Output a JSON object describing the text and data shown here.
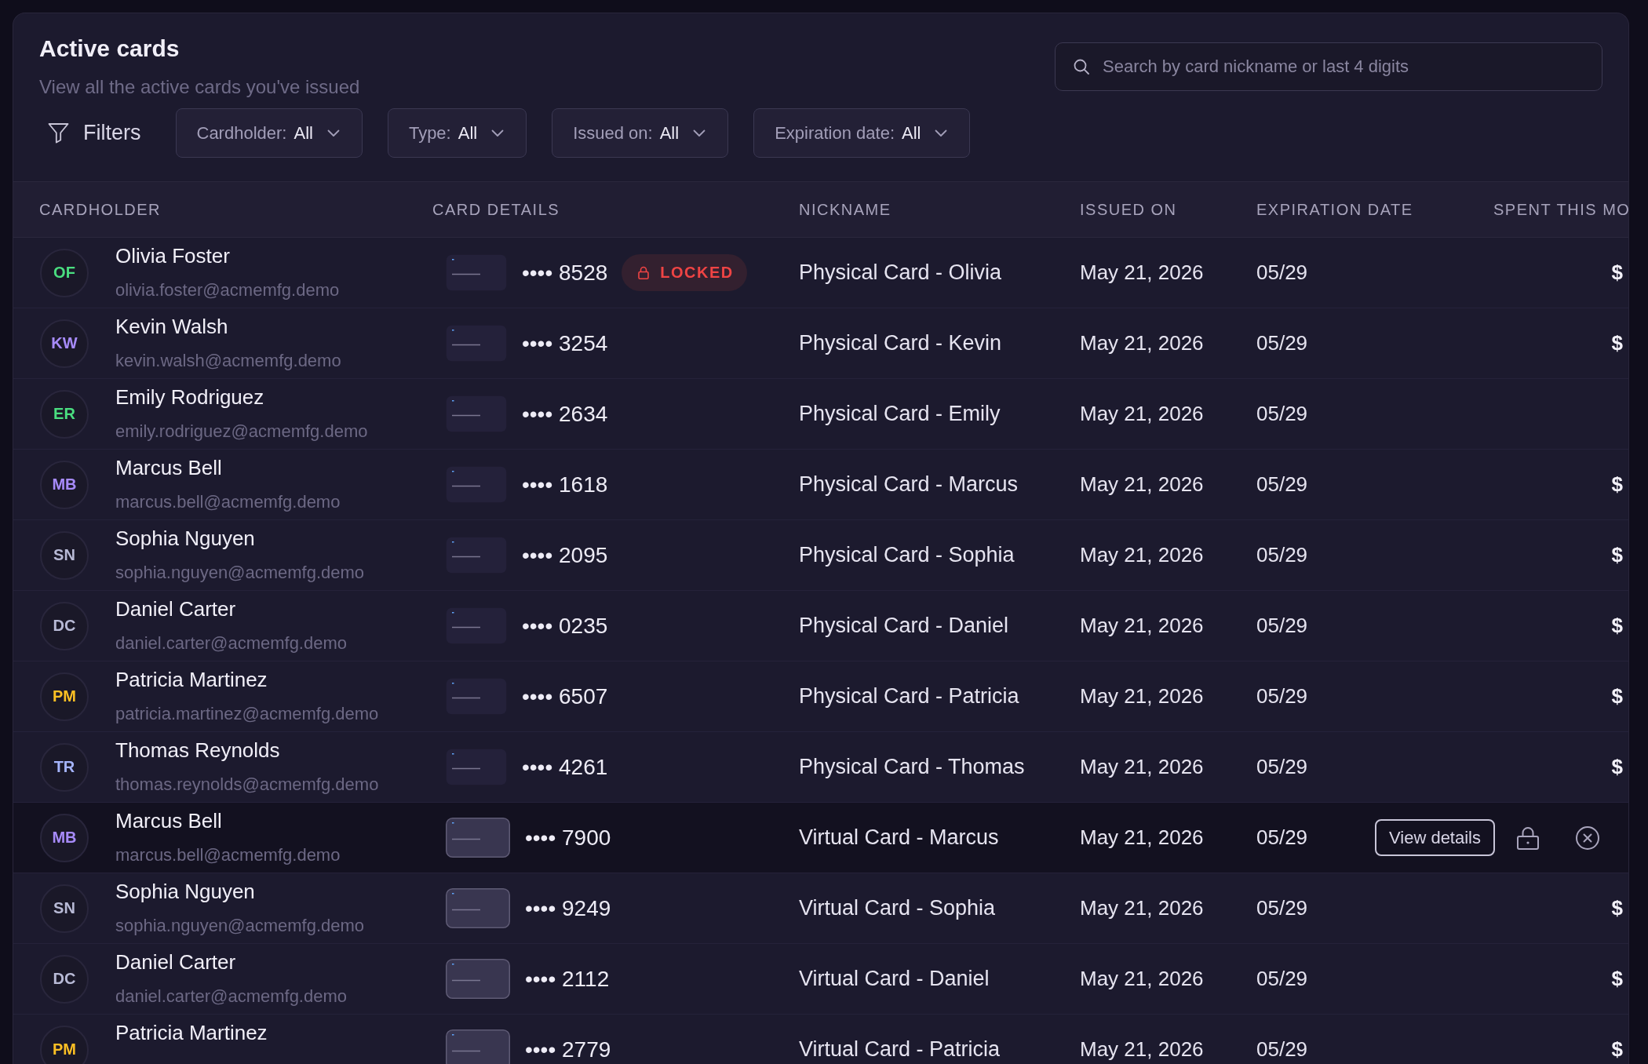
{
  "header": {
    "title": "Active cards",
    "subtitle": "View all the active cards you've issued"
  },
  "search": {
    "placeholder": "Search by card nickname or last 4 digits"
  },
  "filters": {
    "label": "Filters",
    "dropdowns": [
      {
        "label": "Cardholder:",
        "value": "All"
      },
      {
        "label": "Type:",
        "value": "All"
      },
      {
        "label": "Issued on:",
        "value": "All"
      },
      {
        "label": "Expiration date:",
        "value": "All"
      }
    ]
  },
  "table": {
    "columns": [
      "CARDHOLDER",
      "CARD DETAILS",
      "NICKNAME",
      "ISSUED ON",
      "EXPIRATION DATE",
      "SPENT THIS MO"
    ],
    "rows": [
      {
        "initials": "OF",
        "color": "#4ade80",
        "name": "Olivia Foster",
        "email": "olivia.foster@acmemfg.demo",
        "card": {
          "kind": "physical",
          "number": "•••• 8528"
        },
        "badge": "LOCKED",
        "nickname": "Physical Card - Olivia",
        "issued_on": "May 21, 2026",
        "expiration": "05/29",
        "spent": "$",
        "highlighted": false
      },
      {
        "initials": "KW",
        "color": "#a78bfa",
        "name": "Kevin Walsh",
        "email": "kevin.walsh@acmemfg.demo",
        "card": {
          "kind": "physical",
          "number": "•••• 3254"
        },
        "nickname": "Physical Card - Kevin",
        "issued_on": "May 21, 2026",
        "expiration": "05/29",
        "spent": "$",
        "highlighted": false
      },
      {
        "initials": "ER",
        "color": "#4ade80",
        "name": "Emily Rodriguez",
        "email": "emily.rodriguez@acmemfg.demo",
        "card": {
          "kind": "physical",
          "number": "•••• 2634"
        },
        "nickname": "Physical Card - Emily",
        "issued_on": "May 21, 2026",
        "expiration": "05/29",
        "highlighted": false
      },
      {
        "initials": "MB",
        "color": "#a78bfa",
        "name": "Marcus Bell",
        "email": "marcus.bell@acmemfg.demo",
        "card": {
          "kind": "physical",
          "number": "•••• 1618"
        },
        "nickname": "Physical Card - Marcus",
        "issued_on": "May 21, 2026",
        "expiration": "05/29",
        "spent": "$",
        "highlighted": false
      },
      {
        "initials": "SN",
        "color": "#b8bad6",
        "name": "Sophia Nguyen",
        "email": "sophia.nguyen@acmemfg.demo",
        "card": {
          "kind": "physical",
          "number": "•••• 2095"
        },
        "nickname": "Physical Card - Sophia",
        "issued_on": "May 21, 2026",
        "expiration": "05/29",
        "spent": "$",
        "highlighted": false
      },
      {
        "initials": "DC",
        "color": "#b8bad6",
        "name": "Daniel Carter",
        "email": "daniel.carter@acmemfg.demo",
        "card": {
          "kind": "physical",
          "number": "•••• 0235"
        },
        "nickname": "Physical Card - Daniel",
        "issued_on": "May 21, 2026",
        "expiration": "05/29",
        "spent": "$",
        "highlighted": false
      },
      {
        "initials": "PM",
        "color": "#fbbf24",
        "name": "Patricia Martinez",
        "email": "patricia.martinez@acmemfg.demo",
        "card": {
          "kind": "physical",
          "number": "•••• 6507"
        },
        "nickname": "Physical Card - Patricia",
        "issued_on": "May 21, 2026",
        "expiration": "05/29",
        "spent": "$",
        "highlighted": false
      },
      {
        "initials": "TR",
        "color": "#a5b4fc",
        "name": "Thomas Reynolds",
        "email": "thomas.reynolds@acmemfg.demo",
        "card": {
          "kind": "physical",
          "number": "•••• 4261"
        },
        "nickname": "Physical Card - Thomas",
        "issued_on": "May 21, 2026",
        "expiration": "05/29",
        "spent": "$",
        "highlighted": false
      },
      {
        "initials": "MB",
        "color": "#a78bfa",
        "name": "Marcus Bell",
        "email": "marcus.bell@acmemfg.demo",
        "card": {
          "kind": "virtual",
          "number": "•••• 7900"
        },
        "nickname": "Virtual Card - Marcus",
        "issued_on": "May 21, 2026",
        "expiration": "05/29",
        "actions": {
          "button": "View details"
        },
        "highlighted": true
      },
      {
        "initials": "SN",
        "color": "#b8bad6",
        "name": "Sophia Nguyen",
        "email": "sophia.nguyen@acmemfg.demo",
        "card": {
          "kind": "virtual",
          "number": "•••• 9249"
        },
        "nickname": "Virtual Card - Sophia",
        "issued_on": "May 21, 2026",
        "expiration": "05/29",
        "spent": "$",
        "highlighted": false
      },
      {
        "initials": "DC",
        "color": "#b8bad6",
        "name": "Daniel Carter",
        "email": "daniel.carter@acmemfg.demo",
        "card": {
          "kind": "virtual",
          "number": "•••• 2112"
        },
        "nickname": "Virtual Card - Daniel",
        "issued_on": "May 21, 2026",
        "expiration": "05/29",
        "spent": "$",
        "highlighted": false
      },
      {
        "initials": "PM",
        "color": "#fbbf24",
        "name": "Patricia Martinez",
        "card": {
          "kind": "virtual",
          "number": "•••• 2779"
        },
        "nickname": "Virtual Card - Patricia",
        "issued_on": "May 21, 2026",
        "expiration": "05/29",
        "spent": "$",
        "highlighted": false
      }
    ]
  }
}
